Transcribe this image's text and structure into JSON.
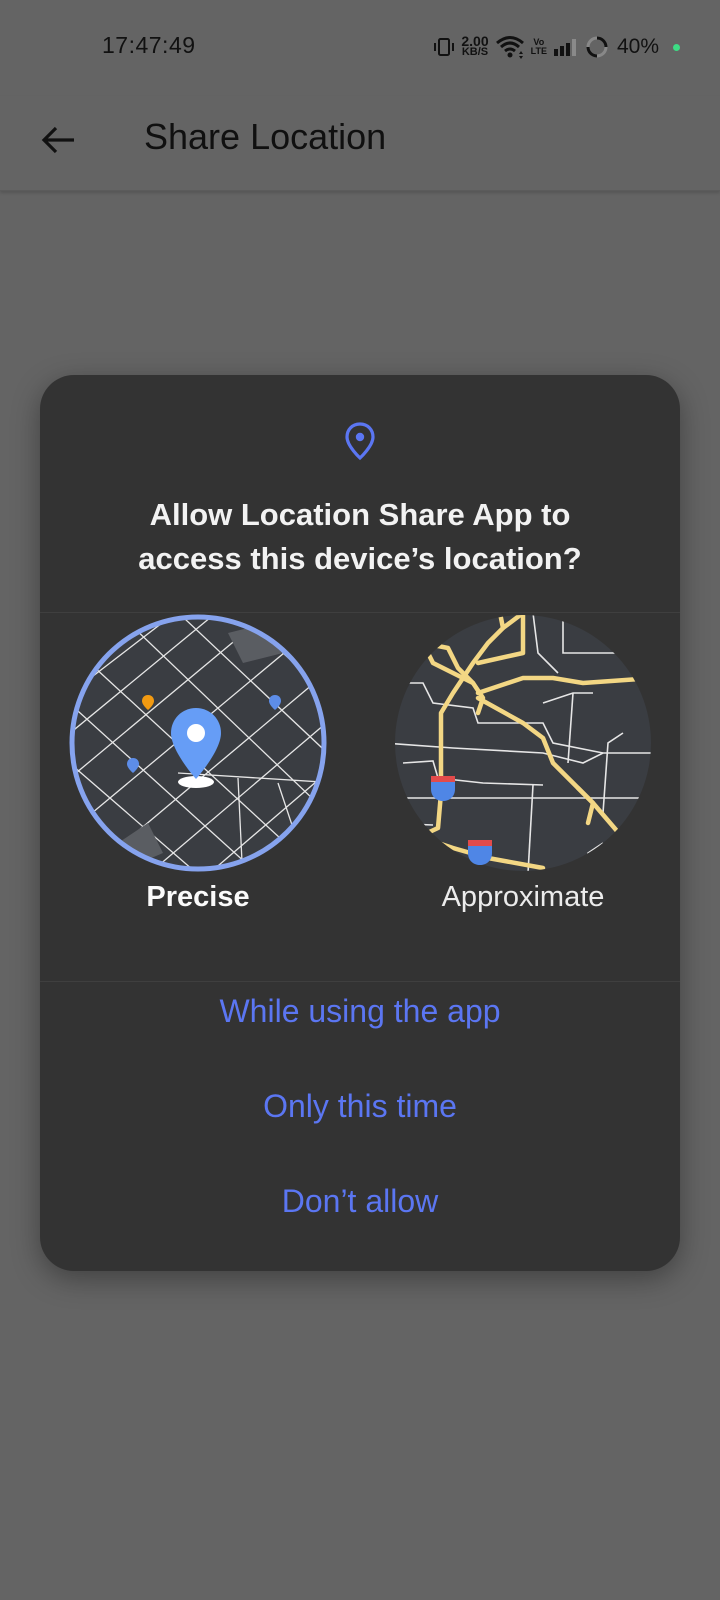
{
  "status_bar": {
    "time": "17:47:49",
    "net_speed_value": "2.00",
    "net_speed_unit": "KB/S",
    "volte_top": "Vo",
    "volte_bottom": "LTE",
    "battery": "40%",
    "dot_color": "#3ddc84"
  },
  "app_bar": {
    "title": "Share Location",
    "back_icon": "arrow-left-icon"
  },
  "dialog": {
    "icon": "location-pin-icon",
    "title_line1": "Allow Location Share App to",
    "title_line2": "access this device’s location?",
    "precise_label": "Precise",
    "approximate_label": "Approximate",
    "selected_option": "Precise",
    "buttons": {
      "while_using": "While using the app",
      "only_this_time": "Only this time",
      "dont_allow": "Don’t allow"
    },
    "accent_color": "#5b76f2"
  }
}
